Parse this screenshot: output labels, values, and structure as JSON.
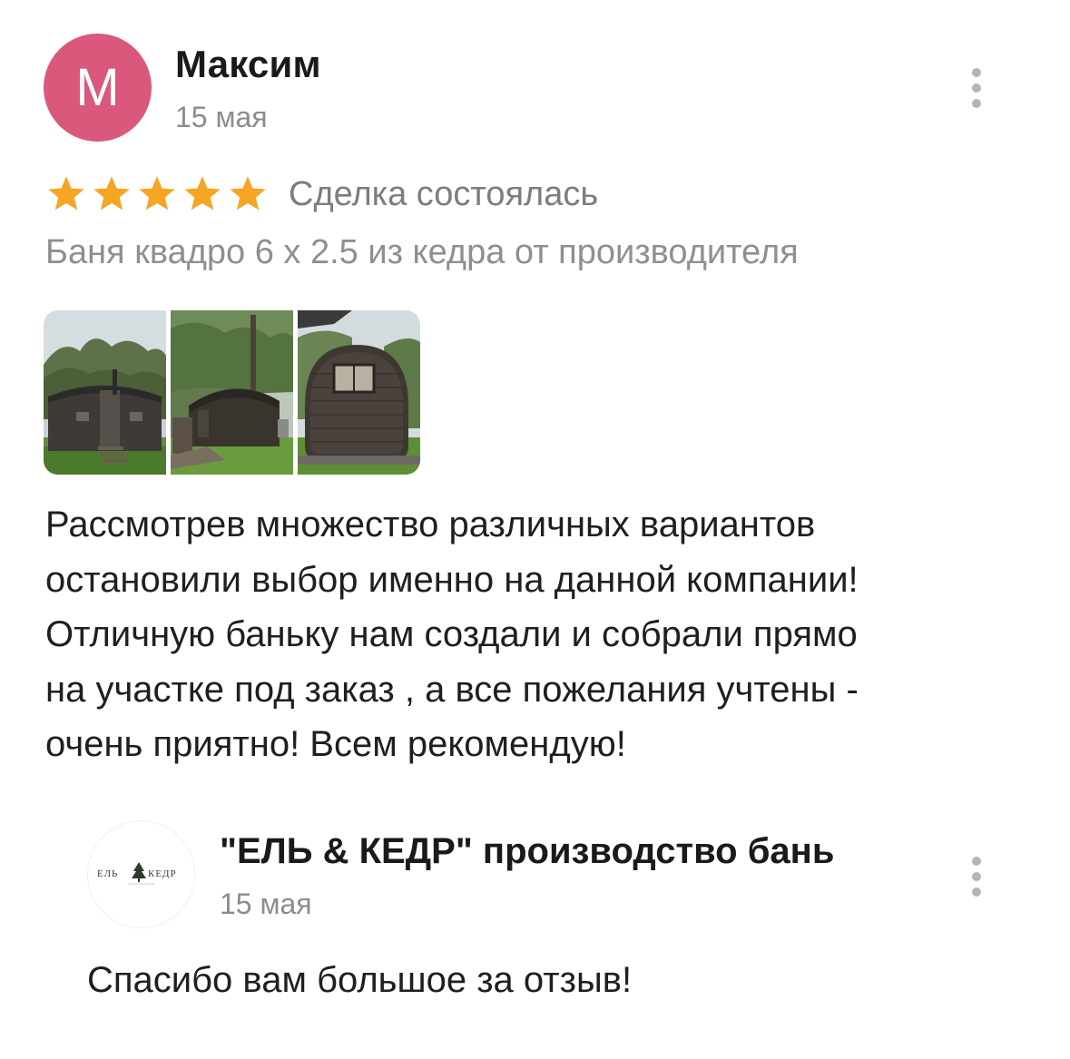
{
  "review": {
    "author": {
      "initial": "М",
      "name": "Максим",
      "avatar_color": "#d9587b"
    },
    "date": "15 мая",
    "rating": 5,
    "star_color": "#f5a623",
    "deal_status": "Сделка состоялась",
    "product_title": "Баня квадро 6 х 2.5 из кедра от производителя",
    "photos": [
      "bath-photo-front",
      "bath-photo-side",
      "bath-photo-back"
    ],
    "text_lines": [
      "Рассмотрев множество различных вариантов",
      "остановили выбор именно на данной компании!",
      "Отличную баньку нам создали и собрали прямо",
      "на участке под заказ , а все пожелания учтены -",
      "очень приятно! Всем рекомендую!"
    ]
  },
  "reply": {
    "logo_text": "ЕЛЬ КЕДР",
    "author": "\"ЕЛЬ & КЕДР\" производство бань",
    "date": "15 мая",
    "text": "Спасибо вам большое за отзыв!"
  },
  "icons": {
    "more": "more-vertical-icon",
    "star": "star-icon"
  }
}
